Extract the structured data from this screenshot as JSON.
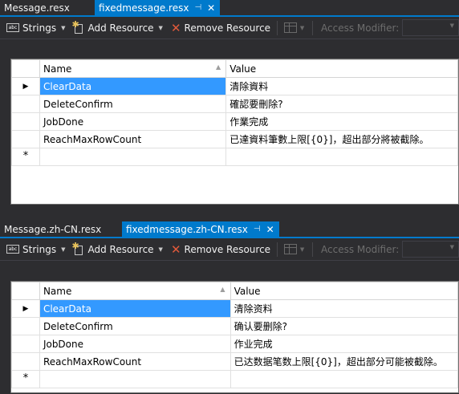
{
  "panes": [
    {
      "tabs": [
        {
          "label": "Message.resx"
        },
        {
          "label": "fixedmessage.resx"
        }
      ],
      "active_tab": 1,
      "toolbar": {
        "strings_label": "Strings",
        "add_resource_label": "Add Resource",
        "remove_resource_label": "Remove Resource",
        "access_modifier_label": "Access Modifier:"
      },
      "grid": {
        "headers": {
          "name": "Name",
          "value": "Value"
        },
        "rows": [
          {
            "name": "ClearData",
            "value": "清除資料"
          },
          {
            "name": "DeleteConfirm",
            "value": "確認要刪除?"
          },
          {
            "name": "JobDone",
            "value": "作業完成"
          },
          {
            "name": "ReachMaxRowCount",
            "value": "已達資料筆數上限[{0}]，超出部分將被截除。"
          }
        ]
      }
    },
    {
      "tabs": [
        {
          "label": "Message.zh-CN.resx"
        },
        {
          "label": "fixedmessage.zh-CN.resx"
        }
      ],
      "active_tab": 1,
      "toolbar": {
        "strings_label": "Strings",
        "add_resource_label": "Add Resource",
        "remove_resource_label": "Remove Resource",
        "access_modifier_label": "Access Modifier:"
      },
      "grid": {
        "headers": {
          "name": "Name",
          "value": "Value"
        },
        "rows": [
          {
            "name": "ClearData",
            "value": "清除资料"
          },
          {
            "name": "DeleteConfirm",
            "value": "确认要删除?"
          },
          {
            "name": "JobDone",
            "value": "作业完成"
          },
          {
            "name": "ReachMaxRowCount",
            "value": "已达数据笔数上限[{0}]，超出部分可能被截除。"
          }
        ]
      }
    }
  ],
  "icons": {
    "pin": "pin-icon",
    "close": "close-icon",
    "strings": "abc-icon",
    "add": "add-resource-icon",
    "remove": "remove-x-icon",
    "view": "grid-view-icon"
  },
  "colors": {
    "accent": "#007acc",
    "selection": "#3399ff",
    "remove_icon": "#e25a3b",
    "background": "#2d2d30"
  }
}
